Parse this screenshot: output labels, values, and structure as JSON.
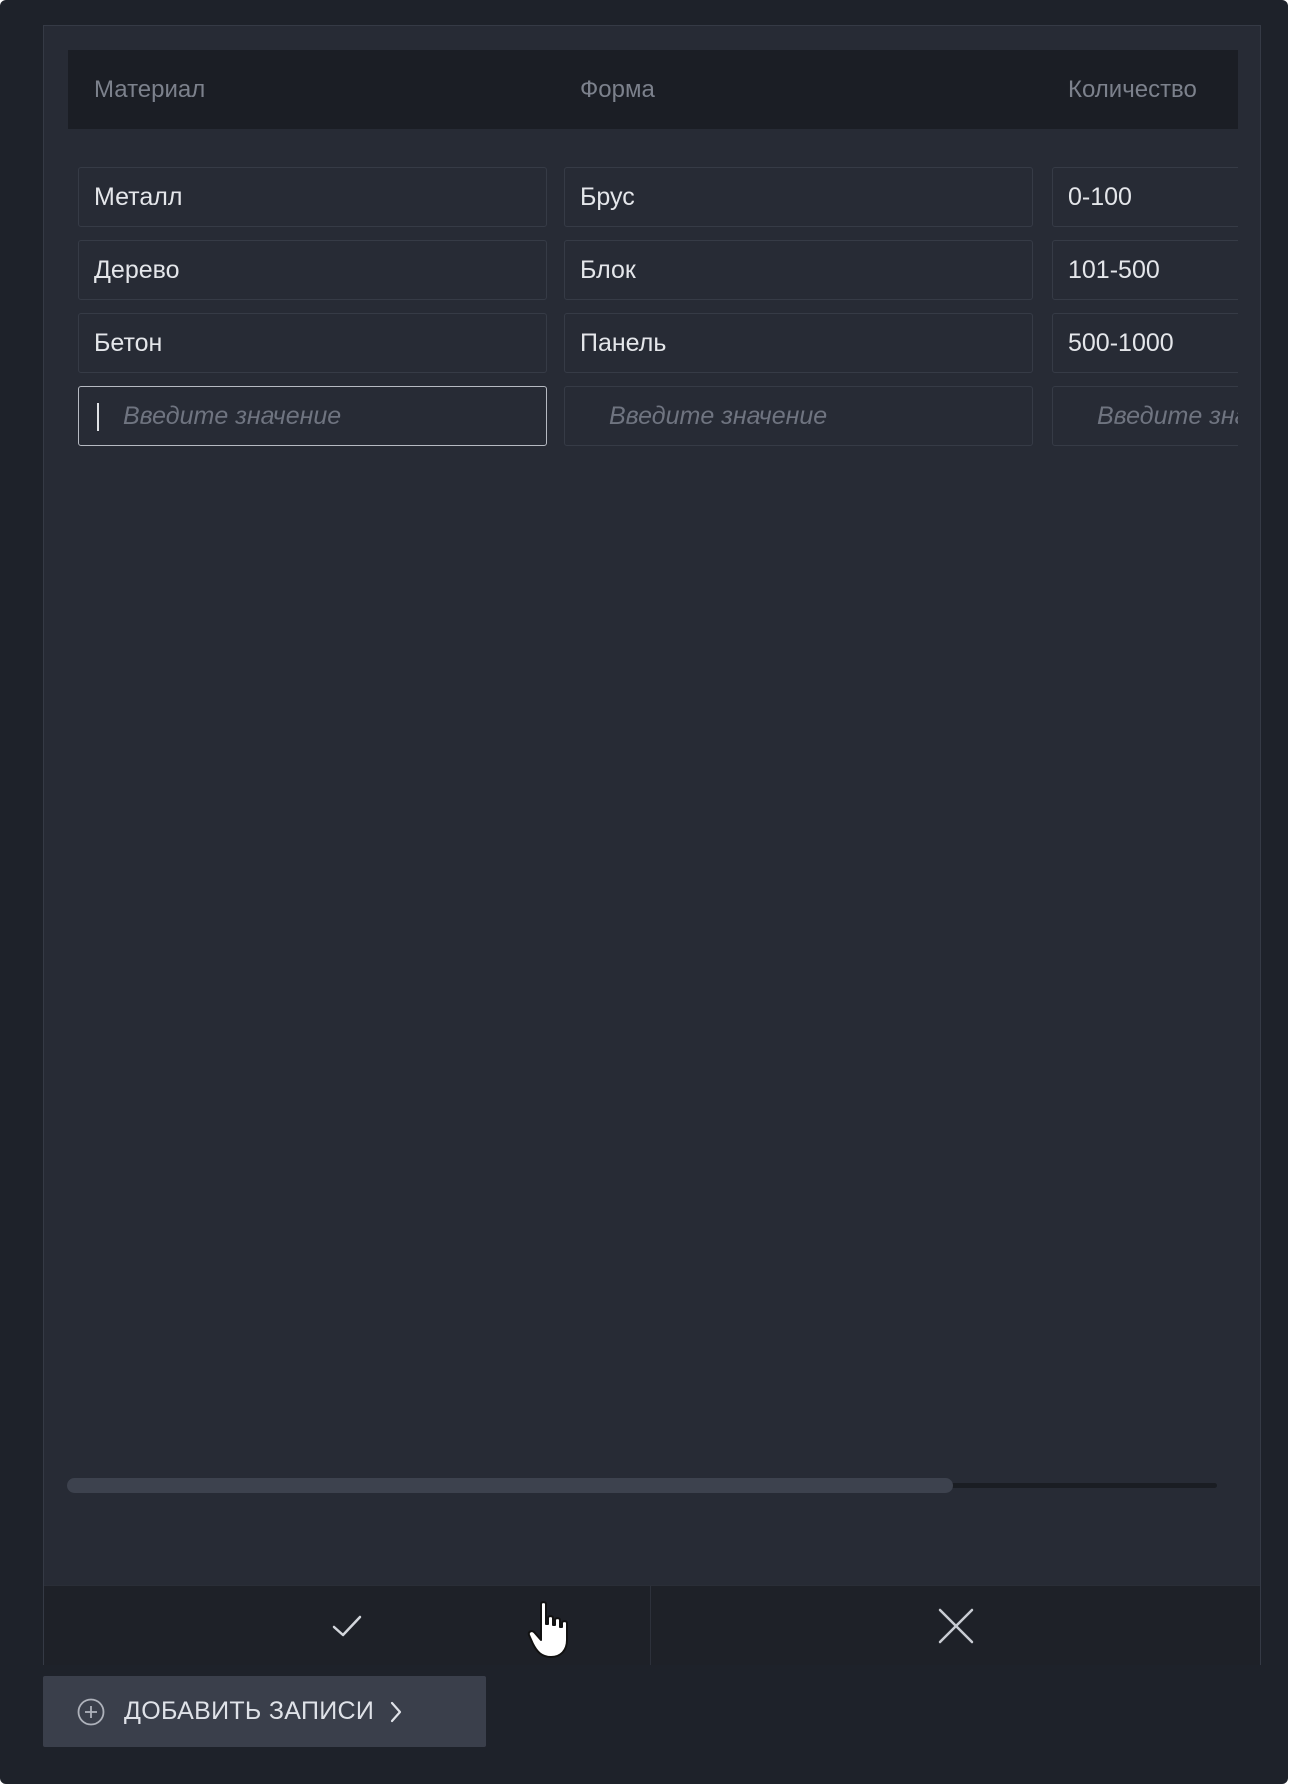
{
  "table": {
    "columns": [
      "Материал",
      "Форма",
      "Количество"
    ],
    "rows": [
      [
        "Металл",
        "Брус",
        "0-100"
      ],
      [
        "Дерево",
        "Блок",
        "101-500"
      ],
      [
        "Бетон",
        "Панель",
        "500-1000"
      ]
    ],
    "new_row_placeholder": "Введите значение"
  },
  "scrollbar": {
    "position_fraction": 0.77
  },
  "footer": {
    "confirm_icon": "check-icon",
    "cancel_icon": "close-icon"
  },
  "add_records": {
    "label": "ДОБАВИТЬ ЗАПИСИ",
    "icon": "plus-circle-icon",
    "trailing_icon": "chevron-right-icon"
  },
  "colors": {
    "background": "#1e222a",
    "panel": "#272b35",
    "header": "#1b1e25",
    "text": "#e4e6ea",
    "muted_text": "#7c818c"
  }
}
